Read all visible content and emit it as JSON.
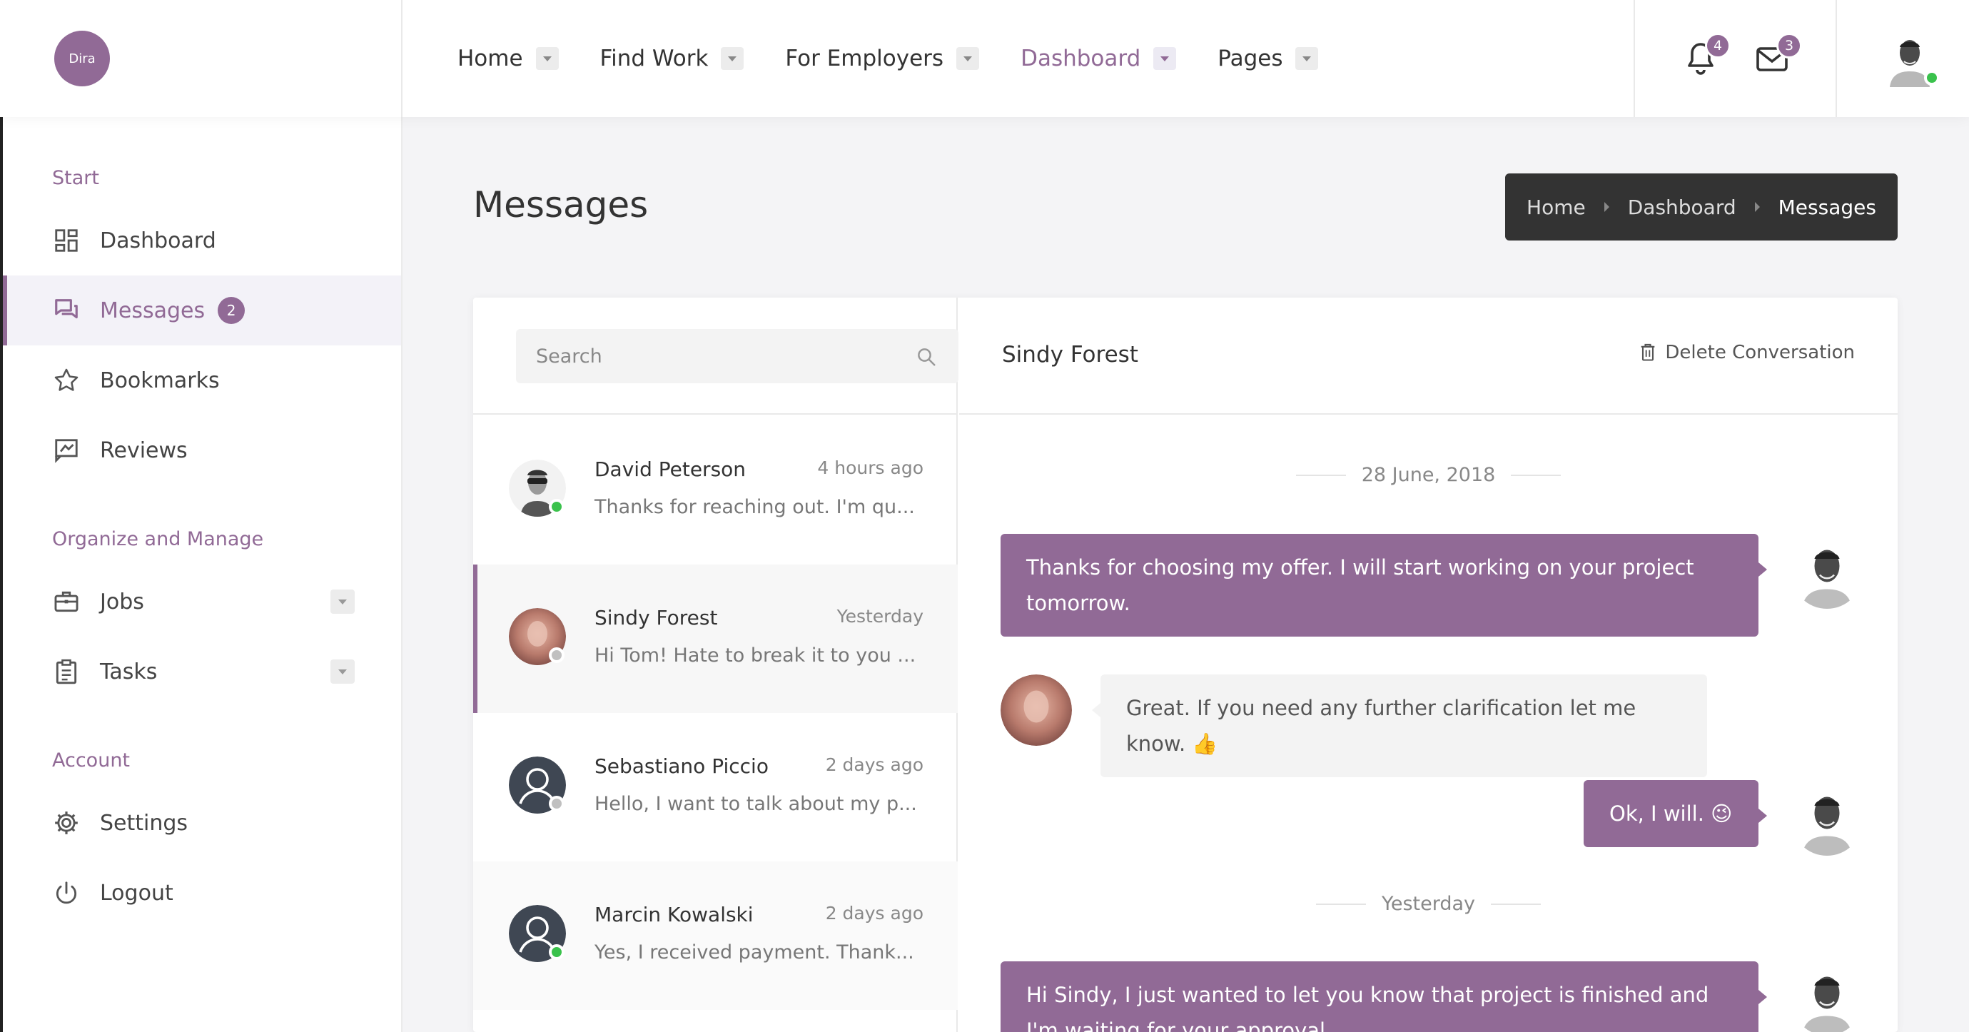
{
  "brand": {
    "logo_text": "Dira",
    "accent": "#916a96"
  },
  "nav": {
    "items": [
      {
        "label": "Home"
      },
      {
        "label": "Find Work"
      },
      {
        "label": "For Employers"
      },
      {
        "label": "Dashboard"
      },
      {
        "label": "Pages"
      }
    ],
    "active": "Dashboard"
  },
  "header": {
    "notifications_count": "4",
    "messages_count": "3",
    "user_status": "online"
  },
  "sidebar": {
    "sections": [
      {
        "title": "Start"
      },
      {
        "title": "Organize and Manage"
      },
      {
        "title": "Account"
      }
    ],
    "items": [
      {
        "label": "Dashboard",
        "icon": "dashboard-icon"
      },
      {
        "label": "Messages",
        "icon": "messages-icon",
        "badge": "2"
      },
      {
        "label": "Bookmarks",
        "icon": "star-icon"
      },
      {
        "label": "Reviews",
        "icon": "reviews-icon"
      },
      {
        "label": "Jobs",
        "icon": "briefcase-icon"
      },
      {
        "label": "Tasks",
        "icon": "clipboard-icon"
      },
      {
        "label": "Settings",
        "icon": "gear-icon"
      },
      {
        "label": "Logout",
        "icon": "power-icon"
      }
    ],
    "active": "Messages"
  },
  "page": {
    "title": "Messages"
  },
  "breadcrumb": [
    "Home",
    "Dashboard",
    "Messages"
  ],
  "inbox": {
    "search_placeholder": "Search",
    "contacts": [
      {
        "name": "David Peterson",
        "time": "4 hours ago",
        "preview": "Thanks for reaching out. I'm qu...",
        "status": "online"
      },
      {
        "name": "Sindy Forest",
        "time": "Yesterday",
        "preview": "Hi Tom! Hate to break it to you ...",
        "status": "offline"
      },
      {
        "name": "Sebastiano Piccio",
        "time": "2 days ago",
        "preview": "Hello, I want to talk about my p...",
        "status": "offline"
      },
      {
        "name": "Marcin Kowalski",
        "time": "2 days ago",
        "preview": "Yes, I received payment. Thank...",
        "status": "online"
      }
    ],
    "active": "Sindy Forest"
  },
  "conversation": {
    "name": "Sindy Forest",
    "delete_label": "Delete Conversation",
    "separators": [
      "28 June, 2018",
      "Yesterday"
    ],
    "messages": [
      {
        "from": "me",
        "text": "Thanks for choosing my offer. I will start working on your project tomorrow."
      },
      {
        "from": "them",
        "text": "Great. If you need any further clarification let me know. 👍"
      },
      {
        "from": "me",
        "text": "Ok, I will. 😉"
      },
      {
        "from": "me",
        "text": "Hi Sindy, I just wanted to let you know that project is finished and I'm waiting for your approval."
      }
    ]
  }
}
